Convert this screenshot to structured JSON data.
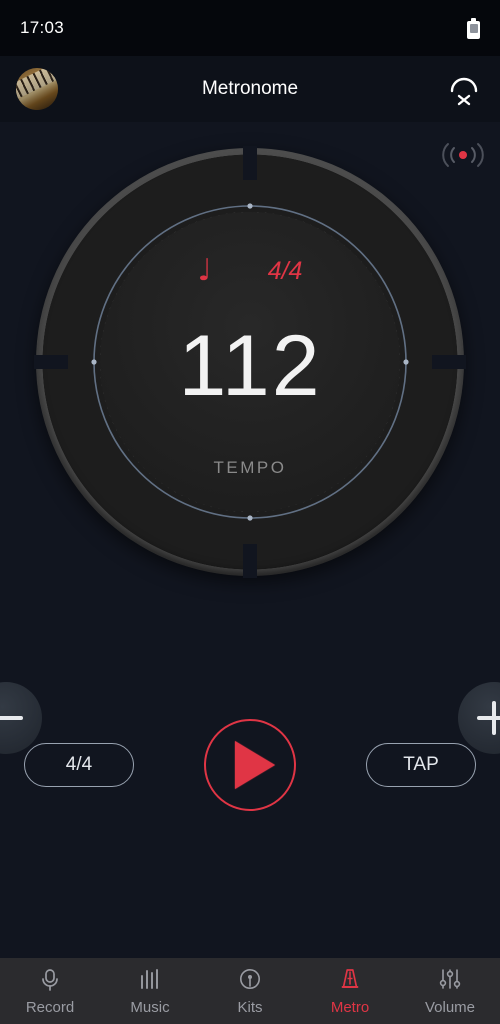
{
  "status_bar": {
    "time": "17:03",
    "battery_icon": "battery-icon"
  },
  "header": {
    "title": "Metronome",
    "avatar_icon": "piano-avatar",
    "action_icon": "pendulum-off-icon"
  },
  "beat_indicator": {
    "icon": "beat-pulse-icon",
    "accent": "#e03545"
  },
  "dial": {
    "note_glyph": "♩",
    "time_signature": "4/4",
    "tempo_value": "112",
    "tempo_label": "TEMPO",
    "accent_color": "#e03545",
    "arc_color": "#6d7f96",
    "ring_color": "#4a4a4a"
  },
  "steppers": {
    "decrease_icon": "minus-icon",
    "increase_icon": "plus-icon"
  },
  "transport": {
    "time_signature_label": "4/4",
    "tap_label": "TAP",
    "play_icon": "play-icon",
    "play_color": "#e03545"
  },
  "nav": {
    "items": [
      {
        "label": "Record",
        "icon": "microphone-icon",
        "active": false
      },
      {
        "label": "Music",
        "icon": "equalizer-icon",
        "active": false
      },
      {
        "label": "Kits",
        "icon": "drum-kit-icon",
        "active": false
      },
      {
        "label": "Metro",
        "icon": "metronome-icon",
        "active": true
      },
      {
        "label": "Volume",
        "icon": "sliders-icon",
        "active": false
      }
    ],
    "active_color": "#e03545",
    "inactive_color": "#9a9ca3"
  }
}
